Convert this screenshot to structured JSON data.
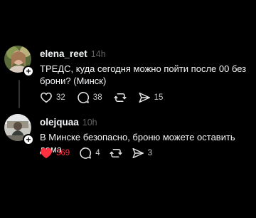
{
  "posts": [
    {
      "username": "elena_reet",
      "time": "14h",
      "text": "ТРЕДС, куда сегодня можно пойти после 00 без брони? (Минск)",
      "likes": "32",
      "replies": "38",
      "shares": "15",
      "liked": false
    },
    {
      "username": "olejquaa",
      "time": "10h",
      "text": "В Минске безопасно, броню можете оставить дома",
      "likes": "369",
      "replies": "4",
      "shares": "3",
      "liked": true
    }
  ],
  "colors": {
    "background": "#000000",
    "text": "#f3f5f7",
    "muted": "#616161",
    "like_active": "#ff3040"
  },
  "icons": {
    "like": "heart-icon",
    "reply": "speech-bubble-icon",
    "repost": "repost-icon",
    "share": "send-icon",
    "follow": "plus-icon"
  }
}
